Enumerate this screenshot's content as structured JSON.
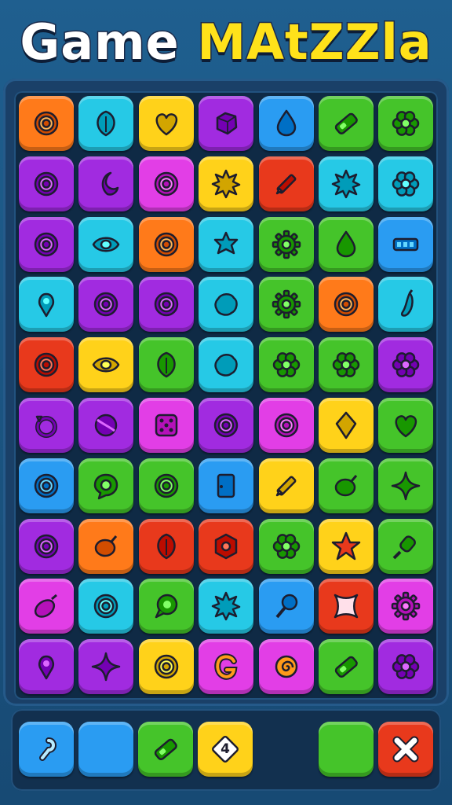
{
  "title": {
    "part1": "Game",
    "part2": "MAtZZla"
  },
  "colors": {
    "orange": "#ff7a1a",
    "cyan": "#26c9e6",
    "yellow": "#ffd21a",
    "purple": "#a12be0",
    "blue": "#2a9cf2",
    "green": "#45c42a",
    "red": "#e8391c",
    "magenta": "#e23ee6",
    "lime": "#5ee21e"
  },
  "board": {
    "rows": [
      [
        {
          "color": "orange",
          "icon": "ring-icon"
        },
        {
          "color": "cyan",
          "icon": "leaf-icon"
        },
        {
          "color": "yellow",
          "icon": "heart-icon"
        },
        {
          "color": "purple",
          "icon": "gem-icon"
        },
        {
          "color": "blue",
          "icon": "drop-icon"
        },
        {
          "color": "green",
          "icon": "bar-icon"
        },
        {
          "color": "green",
          "icon": "flower-icon"
        }
      ],
      [
        {
          "color": "purple",
          "icon": "ring-icon"
        },
        {
          "color": "purple",
          "icon": "moon-icon"
        },
        {
          "color": "magenta",
          "icon": "ring-icon"
        },
        {
          "color": "yellow",
          "icon": "sun-icon"
        },
        {
          "color": "red",
          "icon": "pencil-icon"
        },
        {
          "color": "cyan",
          "icon": "sun-icon"
        },
        {
          "color": "cyan",
          "icon": "flower-icon"
        }
      ],
      [
        {
          "color": "purple",
          "icon": "ring-icon"
        },
        {
          "color": "cyan",
          "icon": "eye-icon"
        },
        {
          "color": "orange",
          "icon": "ring-icon"
        },
        {
          "color": "cyan",
          "icon": "star-blob-icon"
        },
        {
          "color": "green",
          "icon": "gear-icon"
        },
        {
          "color": "green",
          "icon": "drop-icon"
        },
        {
          "color": "blue",
          "icon": "domino-icon"
        }
      ],
      [
        {
          "color": "cyan",
          "icon": "pin-icon"
        },
        {
          "color": "purple",
          "icon": "ring-icon"
        },
        {
          "color": "purple",
          "icon": "ring-icon"
        },
        {
          "color": "cyan",
          "icon": "blob-icon"
        },
        {
          "color": "green",
          "icon": "gear-icon"
        },
        {
          "color": "orange",
          "icon": "ring-icon"
        },
        {
          "color": "cyan",
          "icon": "pepper-icon"
        }
      ],
      [
        {
          "color": "red",
          "icon": "ring-icon"
        },
        {
          "color": "yellow",
          "icon": "eye-icon"
        },
        {
          "color": "green",
          "icon": "leaf-icon"
        },
        {
          "color": "cyan",
          "icon": "blob-icon"
        },
        {
          "color": "green",
          "icon": "flower-icon"
        },
        {
          "color": "green",
          "icon": "flower-icon"
        },
        {
          "color": "purple",
          "icon": "flower-icon"
        }
      ],
      [
        {
          "color": "purple",
          "icon": "circle-arrow-icon"
        },
        {
          "color": "purple",
          "icon": "globe-icon"
        },
        {
          "color": "magenta",
          "icon": "dice-icon"
        },
        {
          "color": "purple",
          "icon": "ring-icon"
        },
        {
          "color": "magenta",
          "icon": "ring-icon"
        },
        {
          "color": "yellow",
          "icon": "diamond-icon"
        },
        {
          "color": "green",
          "icon": "heart-icon"
        }
      ],
      [
        {
          "color": "blue",
          "icon": "ring-icon"
        },
        {
          "color": "green",
          "icon": "chat-ring-icon"
        },
        {
          "color": "green",
          "icon": "ring-icon"
        },
        {
          "color": "blue",
          "icon": "door-icon"
        },
        {
          "color": "yellow",
          "icon": "pencil-icon"
        },
        {
          "color": "green",
          "icon": "lemon-icon"
        },
        {
          "color": "green",
          "icon": "sparkle-icon"
        }
      ],
      [
        {
          "color": "purple",
          "icon": "ring-icon"
        },
        {
          "color": "orange",
          "icon": "lemon-icon"
        },
        {
          "color": "red",
          "icon": "leaf-icon"
        },
        {
          "color": "red",
          "icon": "hexagon-icon"
        },
        {
          "color": "green",
          "icon": "flower-icon"
        },
        {
          "color": "yellow",
          "icon": "star-icon"
        },
        {
          "color": "green",
          "icon": "popsicle-icon"
        }
      ],
      [
        {
          "color": "magenta",
          "icon": "eggplant-icon"
        },
        {
          "color": "cyan",
          "icon": "ring-icon"
        },
        {
          "color": "green",
          "icon": "chat-icon"
        },
        {
          "color": "cyan",
          "icon": "sun-icon"
        },
        {
          "color": "blue",
          "icon": "lollipop-icon"
        },
        {
          "color": "red",
          "icon": "x-star-icon"
        },
        {
          "color": "magenta",
          "icon": "gear-icon"
        }
      ],
      [
        {
          "color": "purple",
          "icon": "pin-icon"
        },
        {
          "color": "purple",
          "icon": "sparkle-icon"
        },
        {
          "color": "yellow",
          "icon": "ring-icon"
        },
        {
          "color": "magenta",
          "icon": "g-letter-icon"
        },
        {
          "color": "magenta",
          "icon": "swirl-icon"
        },
        {
          "color": "green",
          "icon": "bar-icon"
        },
        {
          "color": "purple",
          "icon": "flower-icon"
        }
      ]
    ]
  },
  "tray": {
    "slots": [
      {
        "color": "blue",
        "icon": "hook-icon"
      },
      {
        "color": "blue",
        "icon": ""
      },
      {
        "color": "green",
        "icon": "bar-icon"
      },
      {
        "color": "yellow",
        "icon": "number-card-icon",
        "label": "4"
      },
      {
        "color": "green",
        "icon": ""
      },
      {
        "color": "red",
        "icon": "close-icon"
      }
    ]
  }
}
